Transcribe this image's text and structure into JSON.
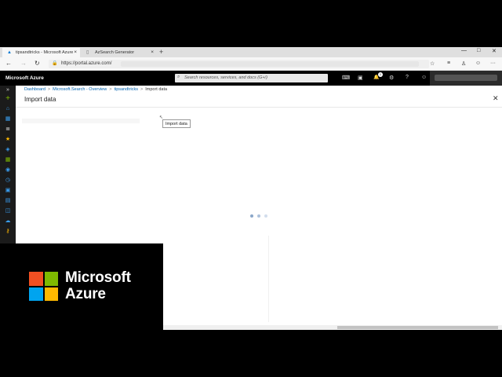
{
  "browser": {
    "tabs": [
      {
        "title": "tipsandtricks - Microsoft Azure",
        "icon": "azure-icon",
        "close": "×",
        "active": true
      },
      {
        "title": "AzSearch Generator",
        "icon": "page-icon",
        "close": "×",
        "active": false
      }
    ],
    "new_tab": "+",
    "window_controls": {
      "minimize": "—",
      "maximize": "□",
      "close": "✕"
    },
    "nav": {
      "back": "←",
      "forward": "→",
      "refresh": "↻"
    },
    "url": "https://portal.azure.com/",
    "toolbar_icons": {
      "favorite": "☆",
      "favorites_bar": "≡",
      "profile": "♙",
      "feedback": "☺",
      "more": "···"
    }
  },
  "azure_bar": {
    "title": "Microsoft Azure",
    "search_placeholder": "Search resources, services, and docs (G+/)",
    "icons": {
      "cloud_shell": "⌨",
      "directory": "▣",
      "notifications": "🔔",
      "notification_count": "1",
      "settings": "⚙",
      "help": "?",
      "feedback": "☺"
    }
  },
  "left_nav": {
    "expand": "»",
    "create": "+",
    "home": "⌂",
    "dashboard": "▦",
    "all_services": "≣",
    "favorites": "★"
  },
  "breadcrumb": {
    "items": [
      "Dashboard",
      "Microsoft.Search - Overview",
      "tipsandtricks"
    ],
    "separator": ">",
    "current": "Import data"
  },
  "blade": {
    "title": "Import data",
    "close": "✕"
  },
  "tooltip": "Import data",
  "cursor": "↖",
  "brand": {
    "line1": "Microsoft",
    "line2": "Azure",
    "logo_colors": [
      "#f25022",
      "#7fba00",
      "#00a4ef",
      "#ffb900"
    ]
  },
  "colors": {
    "accent": "#0078d4",
    "link": "#0063b1"
  }
}
